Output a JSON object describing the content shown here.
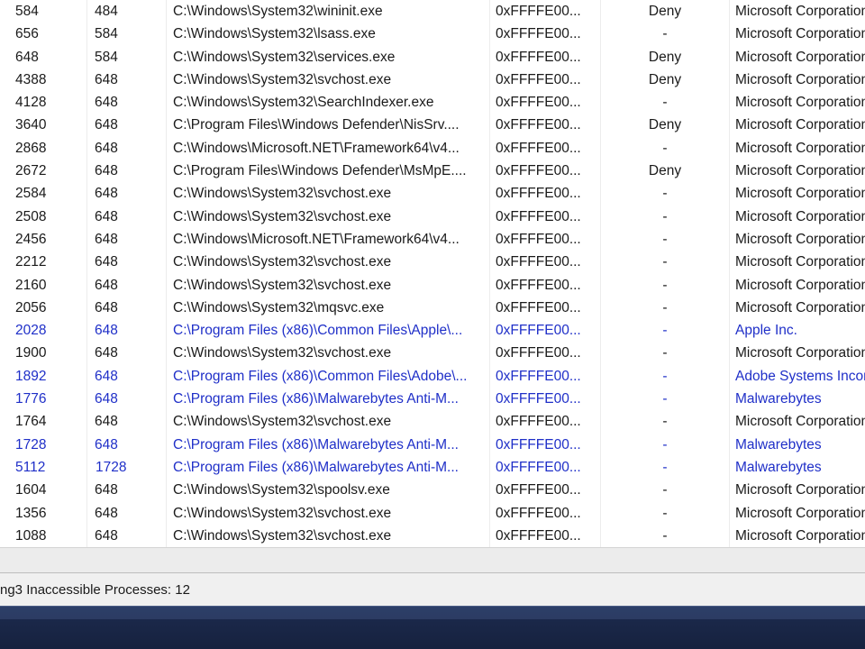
{
  "process_table": {
    "rows": [
      {
        "pid": "584",
        "ppid": "484",
        "path": "C:\\Windows\\System32\\wininit.exe",
        "address": "0xFFFFE00...",
        "dep": "Deny",
        "company": "Microsoft Corporation",
        "highlight": false
      },
      {
        "pid": "656",
        "ppid": "584",
        "path": "C:\\Windows\\System32\\lsass.exe",
        "address": "0xFFFFE00...",
        "dep": "-",
        "company": "Microsoft Corporation",
        "highlight": false
      },
      {
        "pid": "648",
        "ppid": "584",
        "path": "C:\\Windows\\System32\\services.exe",
        "address": "0xFFFFE00...",
        "dep": "Deny",
        "company": "Microsoft Corporation",
        "highlight": false
      },
      {
        "pid": "4388",
        "ppid": "648",
        "path": "C:\\Windows\\System32\\svchost.exe",
        "address": "0xFFFFE00...",
        "dep": "Deny",
        "company": "Microsoft Corporation",
        "highlight": false
      },
      {
        "pid": "4128",
        "ppid": "648",
        "path": "C:\\Windows\\System32\\SearchIndexer.exe",
        "address": "0xFFFFE00...",
        "dep": "-",
        "company": "Microsoft Corporation",
        "highlight": false
      },
      {
        "pid": "3640",
        "ppid": "648",
        "path": "C:\\Program Files\\Windows Defender\\NisSrv....",
        "address": "0xFFFFE00...",
        "dep": "Deny",
        "company": "Microsoft Corporation",
        "highlight": false
      },
      {
        "pid": "2868",
        "ppid": "648",
        "path": "C:\\Windows\\Microsoft.NET\\Framework64\\v4...",
        "address": "0xFFFFE00...",
        "dep": "-",
        "company": "Microsoft Corporation",
        "highlight": false
      },
      {
        "pid": "2672",
        "ppid": "648",
        "path": "C:\\Program Files\\Windows Defender\\MsMpE....",
        "address": "0xFFFFE00...",
        "dep": "Deny",
        "company": "Microsoft Corporation",
        "highlight": false
      },
      {
        "pid": "2584",
        "ppid": "648",
        "path": "C:\\Windows\\System32\\svchost.exe",
        "address": "0xFFFFE00...",
        "dep": "-",
        "company": "Microsoft Corporation",
        "highlight": false
      },
      {
        "pid": "2508",
        "ppid": "648",
        "path": "C:\\Windows\\System32\\svchost.exe",
        "address": "0xFFFFE00...",
        "dep": "-",
        "company": "Microsoft Corporation",
        "highlight": false
      },
      {
        "pid": "2456",
        "ppid": "648",
        "path": "C:\\Windows\\Microsoft.NET\\Framework64\\v4...",
        "address": "0xFFFFE00...",
        "dep": "-",
        "company": "Microsoft Corporation",
        "highlight": false
      },
      {
        "pid": "2212",
        "ppid": "648",
        "path": "C:\\Windows\\System32\\svchost.exe",
        "address": "0xFFFFE00...",
        "dep": "-",
        "company": "Microsoft Corporation",
        "highlight": false
      },
      {
        "pid": "2160",
        "ppid": "648",
        "path": "C:\\Windows\\System32\\svchost.exe",
        "address": "0xFFFFE00...",
        "dep": "-",
        "company": "Microsoft Corporation",
        "highlight": false
      },
      {
        "pid": "2056",
        "ppid": "648",
        "path": "C:\\Windows\\System32\\mqsvc.exe",
        "address": "0xFFFFE00...",
        "dep": "-",
        "company": "Microsoft Corporation",
        "highlight": false
      },
      {
        "pid": "2028",
        "ppid": "648",
        "path": "C:\\Program Files (x86)\\Common Files\\Apple\\...",
        "address": "0xFFFFE00...",
        "dep": "-",
        "company": "Apple Inc.",
        "highlight": true
      },
      {
        "pid": "1900",
        "ppid": "648",
        "path": "C:\\Windows\\System32\\svchost.exe",
        "address": "0xFFFFE00...",
        "dep": "-",
        "company": "Microsoft Corporation",
        "highlight": false
      },
      {
        "pid": "1892",
        "ppid": "648",
        "path": "C:\\Program Files (x86)\\Common Files\\Adobe\\...",
        "address": "0xFFFFE00...",
        "dep": "-",
        "company": "Adobe Systems Incorporated",
        "highlight": true
      },
      {
        "pid": "1776",
        "ppid": "648",
        "path": "C:\\Program Files (x86)\\Malwarebytes Anti-M...",
        "address": "0xFFFFE00...",
        "dep": "-",
        "company": "Malwarebytes",
        "highlight": true
      },
      {
        "pid": "1764",
        "ppid": "648",
        "path": "C:\\Windows\\System32\\svchost.exe",
        "address": "0xFFFFE00...",
        "dep": "-",
        "company": "Microsoft Corporation",
        "highlight": false
      },
      {
        "pid": "1728",
        "ppid": "648",
        "path": "C:\\Program Files (x86)\\Malwarebytes Anti-M...",
        "address": "0xFFFFE00...",
        "dep": "-",
        "company": "Malwarebytes",
        "highlight": true
      },
      {
        "pid": "5112",
        "ppid": "1728",
        "path": "C:\\Program Files (x86)\\Malwarebytes Anti-M...",
        "address": "0xFFFFE00...",
        "dep": "-",
        "company": "Malwarebytes",
        "highlight": true
      },
      {
        "pid": "1604",
        "ppid": "648",
        "path": "C:\\Windows\\System32\\spoolsv.exe",
        "address": "0xFFFFE00...",
        "dep": "-",
        "company": "Microsoft Corporation",
        "highlight": false
      },
      {
        "pid": "1356",
        "ppid": "648",
        "path": "C:\\Windows\\System32\\svchost.exe",
        "address": "0xFFFFE00...",
        "dep": "-",
        "company": "Microsoft Corporation",
        "highlight": false
      },
      {
        "pid": "1088",
        "ppid": "648",
        "path": "C:\\Windows\\System32\\svchost.exe",
        "address": "0xFFFFE00...",
        "dep": "-",
        "company": "Microsoft Corporation",
        "highlight": false
      }
    ]
  },
  "statusbar": {
    "text": "ng3 Inaccessible Processes: 12"
  },
  "colors": {
    "highlight_text": "#1f2fc8",
    "normal_text": "#1a1a1a",
    "taskbar": "#1a2748"
  }
}
